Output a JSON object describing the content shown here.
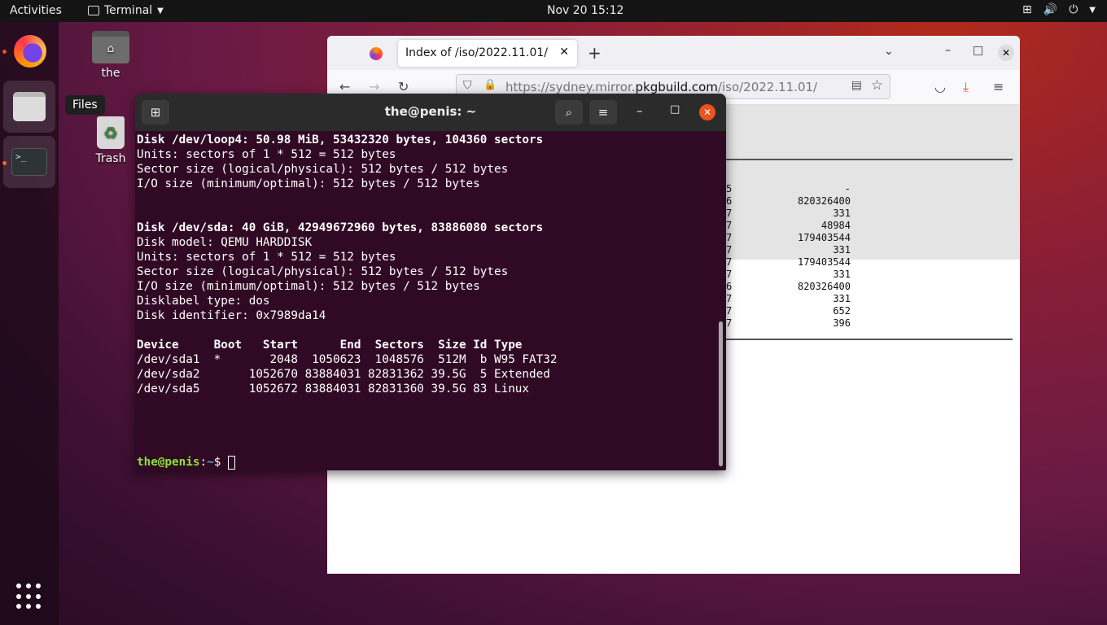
{
  "topbar": {
    "activities": "Activities",
    "app_name": "Terminal",
    "clock": "Nov 20  15:12",
    "tray_icons": [
      "network-icon",
      "volume-icon",
      "power-icon"
    ]
  },
  "dock": {
    "items": [
      "firefox",
      "files",
      "terminal"
    ],
    "tooltip": "Files",
    "running_indicator_color": "#e95420"
  },
  "desktop": {
    "home_label": "the",
    "trash_label": "Trash"
  },
  "firefox": {
    "tab_title": "Index of /iso/2022.11.01/",
    "url_prefix": "https://sydney.mirror.",
    "url_domain": "pkgbuild.com",
    "url_path": "/iso/2022.11.01/",
    "listing": [
      {
        "c1": "5",
        "c2": "-"
      },
      {
        "c1": "6",
        "c2": "820326400"
      },
      {
        "c1": "7",
        "c2": "331"
      },
      {
        "c1": "7",
        "c2": "48984"
      },
      {
        "c1": "7",
        "c2": "179403544"
      },
      {
        "c1": "7",
        "c2": "331"
      },
      {
        "c1": "7",
        "c2": "179403544"
      },
      {
        "c1": "7",
        "c2": "331"
      },
      {
        "c1": "6",
        "c2": "820326400"
      },
      {
        "c1": "7",
        "c2": "331"
      },
      {
        "c1": "7",
        "c2": "652"
      },
      {
        "c1": "7",
        "c2": "396"
      }
    ]
  },
  "terminal": {
    "title": "the@penis: ~",
    "lines": [
      {
        "t": "Disk /dev/loop4: 50.98 MiB, 53432320 bytes, 104360 sectors",
        "bold": true
      },
      {
        "t": "Units: sectors of 1 * 512 = 512 bytes",
        "bold": false
      },
      {
        "t": "Sector size (logical/physical): 512 bytes / 512 bytes",
        "bold": false
      },
      {
        "t": "I/O size (minimum/optimal): 512 bytes / 512 bytes",
        "bold": false
      },
      {
        "t": "",
        "bold": false
      },
      {
        "t": "",
        "bold": false
      },
      {
        "t": "Disk /dev/sda: 40 GiB, 42949672960 bytes, 83886080 sectors",
        "bold": true
      },
      {
        "t": "Disk model: QEMU HARDDISK",
        "bold": false
      },
      {
        "t": "Units: sectors of 1 * 512 = 512 bytes",
        "bold": false
      },
      {
        "t": "Sector size (logical/physical): 512 bytes / 512 bytes",
        "bold": false
      },
      {
        "t": "I/O size (minimum/optimal): 512 bytes / 512 bytes",
        "bold": false
      },
      {
        "t": "Disklabel type: dos",
        "bold": false
      },
      {
        "t": "Disk identifier: 0x7989da14",
        "bold": false
      },
      {
        "t": "",
        "bold": false
      },
      {
        "t": "Device     Boot   Start      End  Sectors  Size Id Type",
        "bold": true
      },
      {
        "t": "/dev/sda1  *       2048  1050623  1048576  512M  b W95 FAT32",
        "bold": false
      },
      {
        "t": "/dev/sda2       1052670 83884031 82831362 39.5G  5 Extended",
        "bold": false
      },
      {
        "t": "/dev/sda5       1052672 83884031 82831360 39.5G 83 Linux",
        "bold": false
      },
      {
        "t": "",
        "bold": false
      },
      {
        "t": "",
        "bold": false
      },
      {
        "t": "",
        "bold": false
      },
      {
        "t": "",
        "bold": false
      }
    ],
    "prompt_user": "the@penis",
    "prompt_sep": ":",
    "prompt_path": "~",
    "prompt_symbol": "$ "
  }
}
